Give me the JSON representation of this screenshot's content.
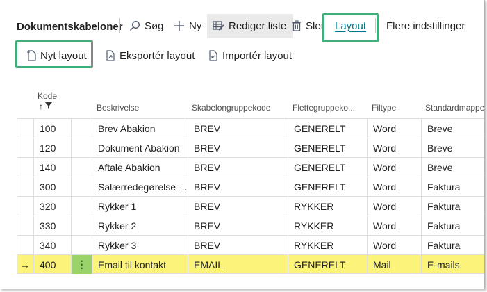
{
  "page": {
    "title": "Dokumentskabeloner"
  },
  "actions": {
    "search": "Søg",
    "new": "Ny",
    "edit_list": "Rediger liste",
    "delete": "Slet",
    "layout": "Layout",
    "more": "Flere indstillinger"
  },
  "layout_actions": {
    "new_layout": "Nyt layout",
    "export_layout": "Eksportér layout",
    "import_layout": "Importér layout"
  },
  "columns": {
    "code": "Kode",
    "code_sort": "↑",
    "description": "Beskrivelse",
    "template_group": "Skabelongruppekode",
    "merge_group": "Flettegruppeko...",
    "file_type": "Filtype",
    "default_folder": "Standardmappe"
  },
  "rows": [
    {
      "code": "100",
      "description": "Brev Abakion",
      "group": "BREV",
      "merge": "GENERELT",
      "type": "Word",
      "folder": "Breve"
    },
    {
      "code": "120",
      "description": "Dokument Abakion",
      "group": "BREV",
      "merge": "GENERELT",
      "type": "Word",
      "folder": "Breve"
    },
    {
      "code": "140",
      "description": "Aftale Abakion",
      "group": "BREV",
      "merge": "GENERELT",
      "type": "Word",
      "folder": "Breve"
    },
    {
      "code": "300",
      "description": "Salærredegørelse -...",
      "group": "BREV",
      "merge": "GENERELT",
      "type": "Word",
      "folder": "Faktura"
    },
    {
      "code": "320",
      "description": "Rykker 1",
      "group": "BREV",
      "merge": "RYKKER",
      "type": "Word",
      "folder": "Faktura"
    },
    {
      "code": "330",
      "description": "Rykker 2",
      "group": "BREV",
      "merge": "RYKKER",
      "type": "Word",
      "folder": "Faktura"
    },
    {
      "code": "340",
      "description": "Rykker 3",
      "group": "BREV",
      "merge": "RYKKER",
      "type": "Word",
      "folder": "Faktura"
    },
    {
      "code": "400",
      "description": "Email til kontakt",
      "group": "EMAIL",
      "merge": "GENERELT",
      "type": "Mail",
      "folder": "E-mails",
      "selected": true,
      "arrow": "→",
      "dots": "⋮"
    }
  ],
  "colors": {
    "highlight_border": "#3fae78",
    "selected_row": "#fbf37a",
    "selected_dots": "#9ad36a",
    "accent": "#00778a"
  }
}
